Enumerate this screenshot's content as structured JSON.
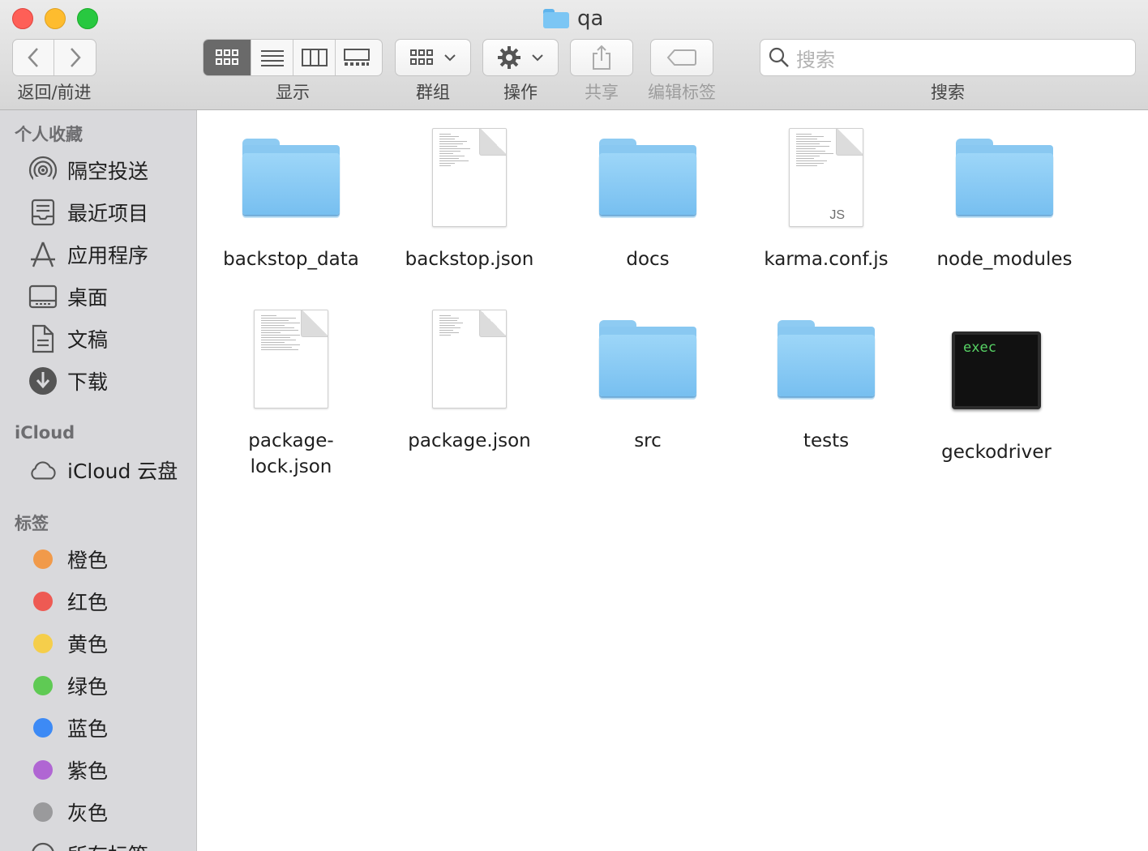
{
  "window": {
    "title": "qa"
  },
  "toolbar": {
    "nav_label": "返回/前进",
    "view_label": "显示",
    "group_label": "群组",
    "action_label": "操作",
    "share_label": "共享",
    "tags_label": "编辑标签",
    "search_label": "搜索",
    "search_placeholder": "搜索",
    "active_view": "icon"
  },
  "sidebar": {
    "favorites_header": "个人收藏",
    "favorites": [
      {
        "label": "隔空投送",
        "icon": "airdrop-icon"
      },
      {
        "label": "最近项目",
        "icon": "recents-icon"
      },
      {
        "label": "应用程序",
        "icon": "applications-icon"
      },
      {
        "label": "桌面",
        "icon": "desktop-icon"
      },
      {
        "label": "文稿",
        "icon": "documents-icon"
      },
      {
        "label": "下载",
        "icon": "downloads-icon"
      }
    ],
    "icloud_header": "iCloud",
    "icloud": [
      {
        "label": "iCloud 云盘",
        "icon": "cloud-icon"
      }
    ],
    "tags_header": "标签",
    "tags": [
      {
        "label": "橙色",
        "color": "#f19a4a"
      },
      {
        "label": "红色",
        "color": "#ee5a53"
      },
      {
        "label": "黄色",
        "color": "#f5ce4b"
      },
      {
        "label": "绿色",
        "color": "#5fca54"
      },
      {
        "label": "蓝色",
        "color": "#3d8af5"
      },
      {
        "label": "紫色",
        "color": "#b066d3"
      },
      {
        "label": "灰色",
        "color": "#9a9a9c"
      }
    ],
    "all_tags": "所有标签…"
  },
  "files": [
    {
      "name": "backstop_data",
      "kind": "folder"
    },
    {
      "name": "backstop.json",
      "kind": "document"
    },
    {
      "name": "docs",
      "kind": "folder"
    },
    {
      "name": "karma.conf.js",
      "kind": "javascript",
      "badge": "JS"
    },
    {
      "name": "node_modules",
      "kind": "folder"
    },
    {
      "name": "package-lock.json",
      "kind": "document"
    },
    {
      "name": "package.json",
      "kind": "document"
    },
    {
      "name": "src",
      "kind": "folder"
    },
    {
      "name": "tests",
      "kind": "folder"
    },
    {
      "name": "geckodriver",
      "kind": "executable",
      "badge": "exec"
    }
  ]
}
